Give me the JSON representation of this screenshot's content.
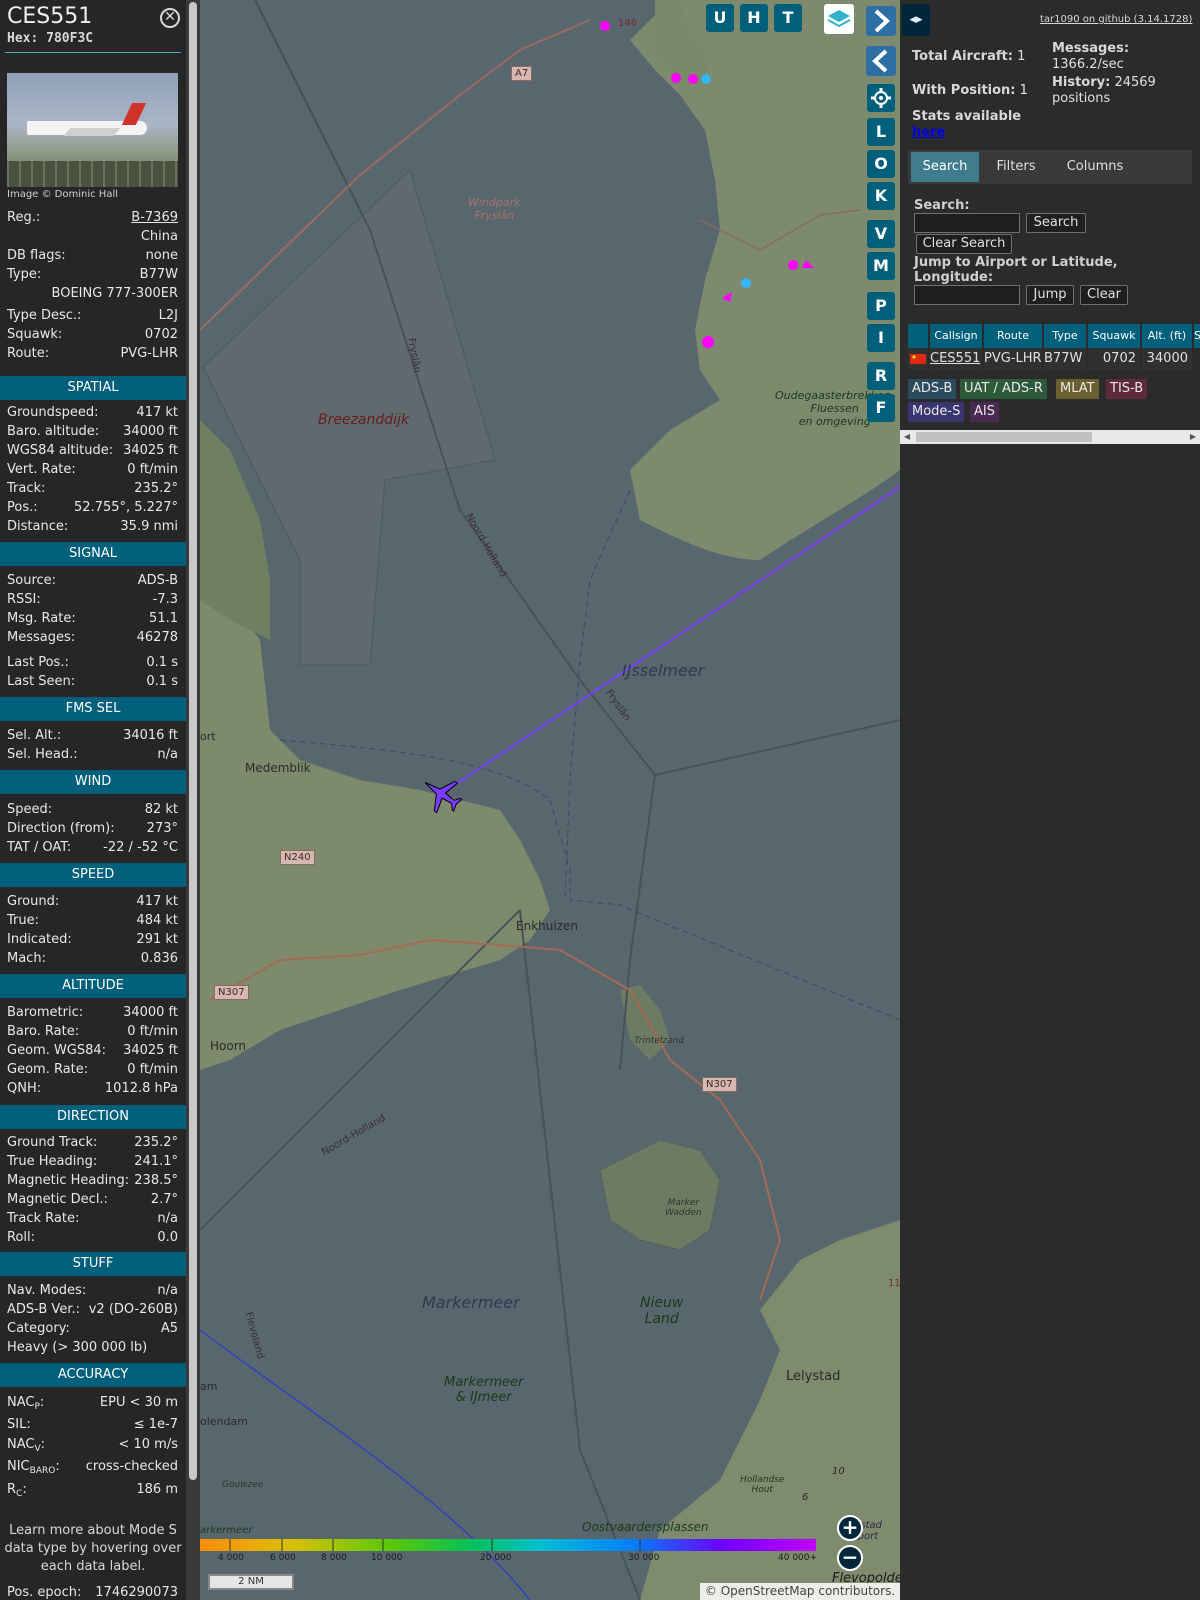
{
  "aircraft": {
    "callsign": "CES551",
    "hex": "Hex: 780F3C",
    "close_icon": "close-icon",
    "photo_credit": "Image © Dominic Hall"
  },
  "info": {
    "reg_label": "Reg.:",
    "reg_value": "B-7369",
    "country": "China",
    "dbflags_label": "DB flags:",
    "dbflags_value": "none",
    "type_label": "Type:",
    "type_value": "B77W",
    "type_full": "BOEING 777-300ER",
    "typedesc_label": "Type Desc.:",
    "typedesc_value": "L2J",
    "squawk_label": "Squawk:",
    "squawk_value": "0702",
    "route_label": "Route:",
    "route_value": "PVG-LHR"
  },
  "spatial": {
    "title": "SPATIAL",
    "rows": [
      {
        "k": "Groundspeed:",
        "v": "417 kt"
      },
      {
        "k": "Baro. altitude:",
        "v": "34000 ft"
      },
      {
        "k": "WGS84 altitude:",
        "v": "34025 ft"
      },
      {
        "k": "Vert. Rate:",
        "v": "0 ft/min"
      },
      {
        "k": "Track:",
        "v": "235.2°"
      },
      {
        "k": "Pos.:",
        "v": "52.755°, 5.227°"
      },
      {
        "k": "Distance:",
        "v": "35.9 nmi"
      }
    ]
  },
  "signal": {
    "title": "SIGNAL",
    "rows": [
      {
        "k": "Source:",
        "v": "ADS-B"
      },
      {
        "k": "RSSI:",
        "v": "-7.3"
      },
      {
        "k": "Msg. Rate:",
        "v": "51.1"
      },
      {
        "k": "Messages:",
        "v": "46278"
      },
      {
        "k": "Last Pos.:",
        "v": "0.1 s"
      },
      {
        "k": "Last Seen:",
        "v": "0.1 s"
      }
    ]
  },
  "fms": {
    "title": "FMS SEL",
    "rows": [
      {
        "k": "Sel. Alt.:",
        "v": "34016 ft"
      },
      {
        "k": "Sel. Head.:",
        "v": "n/a"
      }
    ]
  },
  "wind": {
    "title": "WIND",
    "rows": [
      {
        "k": "Speed:",
        "v": "82 kt"
      },
      {
        "k": "Direction (from):",
        "v": "273°"
      },
      {
        "k": "TAT / OAT:",
        "v": "-22 / -52 °C"
      }
    ]
  },
  "speed": {
    "title": "SPEED",
    "rows": [
      {
        "k": "Ground:",
        "v": "417 kt"
      },
      {
        "k": "True:",
        "v": "484 kt"
      },
      {
        "k": "Indicated:",
        "v": "291 kt"
      },
      {
        "k": "Mach:",
        "v": "0.836"
      }
    ]
  },
  "altitude": {
    "title": "ALTITUDE",
    "rows": [
      {
        "k": "Barometric:",
        "v": "34000 ft"
      },
      {
        "k": "Baro. Rate:",
        "v": "0 ft/min"
      },
      {
        "k": "Geom. WGS84:",
        "v": "34025 ft"
      },
      {
        "k": "Geom. Rate:",
        "v": "0 ft/min"
      },
      {
        "k": "QNH:",
        "v": "1012.8 hPa"
      }
    ]
  },
  "direction": {
    "title": "DIRECTION",
    "rows": [
      {
        "k": "Ground Track:",
        "v": "235.2°"
      },
      {
        "k": "True Heading:",
        "v": "241.1°"
      },
      {
        "k": "Magnetic Heading:",
        "v": "238.5°"
      },
      {
        "k": "Magnetic Decl.:",
        "v": "2.7°"
      },
      {
        "k": "Track Rate:",
        "v": "n/a"
      },
      {
        "k": "Roll:",
        "v": "0.0"
      }
    ]
  },
  "stuff": {
    "title": "STUFF",
    "navmodes_label": "Nav. Modes:",
    "navmodes_value": "n/a",
    "adsbver_label": "ADS-B Ver.:",
    "adsbver_value": "v2 (DO-260B)",
    "category_label": "Category:",
    "category_value": "A5",
    "category_desc": "Heavy (> 300 000 lb)"
  },
  "accuracy": {
    "title": "ACCURACY",
    "nacp_label": "NAC",
    "nacp_sub": "P",
    "nacp_value": "EPU < 30 m",
    "sil_label": "SIL:",
    "sil_value": "≤ 1e-7",
    "nacv_label": "NAC",
    "nacv_sub": "V",
    "nacv_value": "< 10 m/s",
    "nicbaro_label": "NIC",
    "nicbaro_sub": "BARO",
    "nicbaro_value": "cross-checked",
    "rc_label": "R",
    "rc_sub": "C",
    "rc_value": "186 m",
    "colon": ":"
  },
  "learn_more": "Learn more about Mode S data type by hovering over each data label.",
  "epoch": {
    "k": "Pos. epoch:",
    "v": "1746290073"
  },
  "map": {
    "labels": {
      "windpark": "Windpark\nFryslân",
      "breezanddijk": "Breezanddijk",
      "ijsselmeer": "IJsselmeer",
      "medemblik": "Medemblik",
      "enkhuizen": "Enkhuizen",
      "hoorn": "Hoorn",
      "markermeer": "Markermeer",
      "markermeer_ijmeer": "Markermeer\n& IJmeer",
      "nieuw_land": "Nieuw\nLand",
      "lelystad": "Lelystad",
      "trintelzand": "Trintelzand",
      "marker_wadden": "Marker\nWadden",
      "oudegaasterbrekken": "Oudegaasterbrekken,\nFluessen\nen omgeving",
      "noord_holland_1": "Noord-Holland",
      "noord_holland_2": "Noord-Holland",
      "fryslan_1": "Fryslân",
      "fryslan_2": "Fryslân",
      "flevoland": "Flevoland",
      "oostvaardersplassen": "Oostvaardersplassen",
      "lelystad_airport": "Lelystad\nAirport",
      "gouwzee": "Gouwzee",
      "ort": "ort",
      "am": "am",
      "olendam": "olendam",
      "arkermeer": "arkermeer",
      "flevopolder": "Flevopolde",
      "hollandse_hout": "Hollandse\nHout"
    },
    "roads": {
      "a7": "A7",
      "n240": "N240",
      "n307a": "N307",
      "n307b": "N307",
      "r146": "146",
      "r11": "11",
      "r10": "10",
      "r6": "6"
    },
    "top_buttons": [
      "U",
      "H",
      "T"
    ],
    "side_buttons": [
      "L",
      "O",
      "K",
      "V",
      "M",
      "P",
      "I",
      "R",
      "F"
    ],
    "icons": {
      "layers": "layers-icon",
      "next": "chevron-right-icon",
      "prev": "chevron-left-icon",
      "settings": "gear-icon",
      "zoom_in": "plus-icon",
      "zoom_out": "minus-icon"
    },
    "altitude_scale": [
      "4 000",
      "6 000",
      "8 000",
      "10 000",
      "20 000",
      "30 000",
      "40 000+"
    ],
    "scale_bar": "2 NM",
    "attribution_prefix": "© ",
    "attribution_link": "OpenStreetMap",
    "attribution_suffix": " contributors."
  },
  "sidebar": {
    "github": "tar1090 on github (3.14.1728)",
    "total_aircraft_label": "Total Aircraft:",
    "total_aircraft_value": "1",
    "with_position_label": "With Position:",
    "with_position_value": "1",
    "messages_label": "Messages:",
    "messages_value": "1366.2/sec",
    "history_label": "History:",
    "history_value": "24569 positions",
    "stats_text": "Stats available",
    "stats_link": "here",
    "tabs": [
      "Search",
      "Filters",
      "Columns"
    ],
    "search_label": "Search:",
    "search_button": "Search",
    "clear_search_button": "Clear Search",
    "jump_label": "Jump to Airport or Latitude, Longitude:",
    "jump_button": "Jump",
    "clear_button": "Clear",
    "table": {
      "headers": [
        "",
        "Callsign",
        "Route",
        "Type",
        "Squawk",
        "Alt. (ft)",
        "S"
      ],
      "rows": [
        {
          "flag": "china-flag-icon",
          "callsign": "CES551",
          "route": "PVG-LHR",
          "type": "B77W",
          "squawk": "0702",
          "alt": "34000"
        }
      ]
    },
    "sources": [
      "ADS-B",
      "UAT / ADS-R",
      "MLAT",
      "TIS-B",
      "Mode-S",
      "AIS"
    ],
    "colors": {
      "accent": "#005f7a",
      "adsb": "#2b4b5e",
      "uat": "#2e5a3c",
      "mlat": "#6a5f2e",
      "tisb": "#5e2a3a",
      "modes": "#3a3470",
      "ais": "#4a2a52"
    }
  }
}
